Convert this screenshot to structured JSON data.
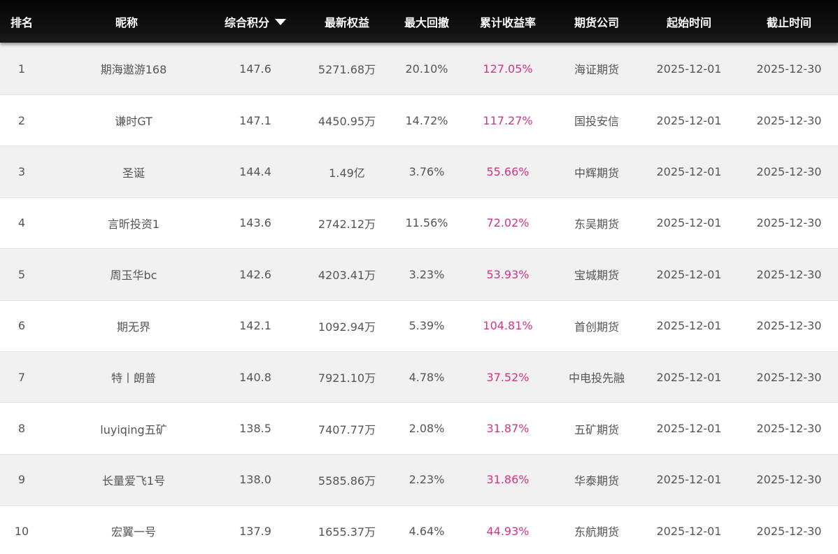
{
  "header": {
    "rank": "排名",
    "nickname": "昵称",
    "score": "综合积分",
    "equity": "最新权益",
    "max_drawdown": "最大回撤",
    "cumulative_return": "累计收益率",
    "firm": "期货公司",
    "start_time": "起始时间",
    "end_time": "截止时间",
    "sort_icon": "caret-down-icon"
  },
  "colors": {
    "header_bg": "#0d0d0d",
    "return_text": "#d63384",
    "odd_row": "#f1f1f1",
    "even_row": "#ffffff"
  },
  "rows": [
    {
      "rank": "1",
      "nickname": "期海遨游168",
      "score": "147.6",
      "equity": "5271.68万",
      "max_drawdown": "20.10%",
      "cumulative_return": "127.05%",
      "firm": "海证期货",
      "start_time": "2025-12-01",
      "end_time": "2025-12-30"
    },
    {
      "rank": "2",
      "nickname": "谦时GT",
      "score": "147.1",
      "equity": "4450.95万",
      "max_drawdown": "14.72%",
      "cumulative_return": "117.27%",
      "firm": "国投安信",
      "start_time": "2025-12-01",
      "end_time": "2025-12-30"
    },
    {
      "rank": "3",
      "nickname": "圣诞",
      "score": "144.4",
      "equity": "1.49亿",
      "max_drawdown": "3.76%",
      "cumulative_return": "55.66%",
      "firm": "中辉期货",
      "start_time": "2025-12-01",
      "end_time": "2025-12-30"
    },
    {
      "rank": "4",
      "nickname": "言昕投资1",
      "score": "143.6",
      "equity": "2742.12万",
      "max_drawdown": "11.56%",
      "cumulative_return": "72.02%",
      "firm": "东吴期货",
      "start_time": "2025-12-01",
      "end_time": "2025-12-30"
    },
    {
      "rank": "5",
      "nickname": "周玉华bc",
      "score": "142.6",
      "equity": "4203.41万",
      "max_drawdown": "3.23%",
      "cumulative_return": "53.93%",
      "firm": "宝城期货",
      "start_time": "2025-12-01",
      "end_time": "2025-12-30"
    },
    {
      "rank": "6",
      "nickname": "期无界",
      "score": "142.1",
      "equity": "1092.94万",
      "max_drawdown": "5.39%",
      "cumulative_return": "104.81%",
      "firm": "首创期货",
      "start_time": "2025-12-01",
      "end_time": "2025-12-30"
    },
    {
      "rank": "7",
      "nickname": "特丨朗普",
      "score": "140.8",
      "equity": "7921.10万",
      "max_drawdown": "4.78%",
      "cumulative_return": "37.52%",
      "firm": "中电投先融",
      "start_time": "2025-12-01",
      "end_time": "2025-12-30"
    },
    {
      "rank": "8",
      "nickname": "luyiqing五矿",
      "score": "138.5",
      "equity": "7407.77万",
      "max_drawdown": "2.08%",
      "cumulative_return": "31.87%",
      "firm": "五矿期货",
      "start_time": "2025-12-01",
      "end_time": "2025-12-30"
    },
    {
      "rank": "9",
      "nickname": "长量爱飞1号",
      "score": "138.0",
      "equity": "5585.86万",
      "max_drawdown": "2.23%",
      "cumulative_return": "31.86%",
      "firm": "华泰期货",
      "start_time": "2025-12-01",
      "end_time": "2025-12-30"
    },
    {
      "rank": "10",
      "nickname": "宏翼一号",
      "score": "137.9",
      "equity": "1655.37万",
      "max_drawdown": "4.64%",
      "cumulative_return": "44.93%",
      "firm": "东航期货",
      "start_time": "2025-12-01",
      "end_time": "2025-12-30"
    }
  ]
}
